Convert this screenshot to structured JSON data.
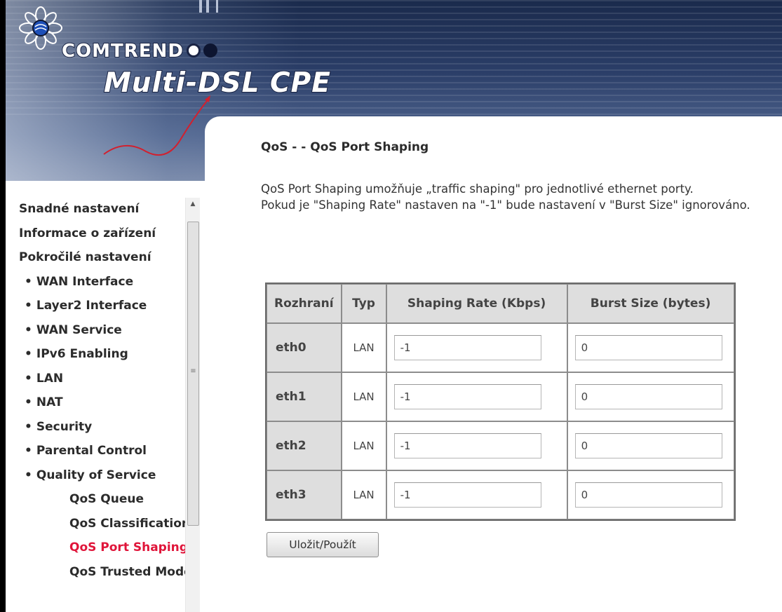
{
  "header": {
    "brand": "COMTREND",
    "product": "Multi-DSL CPE"
  },
  "sidebar": {
    "items": [
      {
        "label": "Snadné nastavení",
        "level": 0
      },
      {
        "label": "Informace o zařízení",
        "level": 0
      },
      {
        "label": "Pokročilé nastavení",
        "level": 0
      },
      {
        "label": "WAN Interface",
        "level": 1
      },
      {
        "label": "Layer2 Interface",
        "level": 1
      },
      {
        "label": "WAN Service",
        "level": 1
      },
      {
        "label": "IPv6 Enabling",
        "level": 1
      },
      {
        "label": "LAN",
        "level": 1
      },
      {
        "label": "NAT",
        "level": 1
      },
      {
        "label": "Security",
        "level": 1
      },
      {
        "label": "Parental Control",
        "level": 1
      },
      {
        "label": "Quality of Service",
        "level": 1
      },
      {
        "label": "QoS Queue",
        "level": 2
      },
      {
        "label": "QoS Classification",
        "level": 2
      },
      {
        "label": "QoS Port Shaping",
        "level": 2,
        "active": true
      },
      {
        "label": "QoS Trusted Mode",
        "level": 2
      }
    ],
    "bullet": "•"
  },
  "main": {
    "title": "QoS - - QoS Port Shaping",
    "desc1": "QoS Port Shaping umožňuje „traffic shaping\" pro jednotlivé ethernet porty.",
    "desc2": "Pokud je \"Shaping Rate\" nastaven na \"-1\" bude nastavení v \"Burst Size\" ignorováno.",
    "table": {
      "headers": [
        "Rozhraní",
        "Typ",
        "Shaping Rate (Kbps)",
        "Burst Size (bytes)"
      ],
      "rows": [
        {
          "iface": "eth0",
          "typ": "LAN",
          "rate": "-1",
          "burst": "0"
        },
        {
          "iface": "eth1",
          "typ": "LAN",
          "rate": "-1",
          "burst": "0"
        },
        {
          "iface": "eth2",
          "typ": "LAN",
          "rate": "-1",
          "burst": "0"
        },
        {
          "iface": "eth3",
          "typ": "LAN",
          "rate": "-1",
          "burst": "0"
        }
      ]
    },
    "save_label": "Uložit/Použít"
  },
  "colors": {
    "active_nav": "#e0153a",
    "header_dark": "#1a2a4c",
    "table_header_bg": "#dedede"
  }
}
